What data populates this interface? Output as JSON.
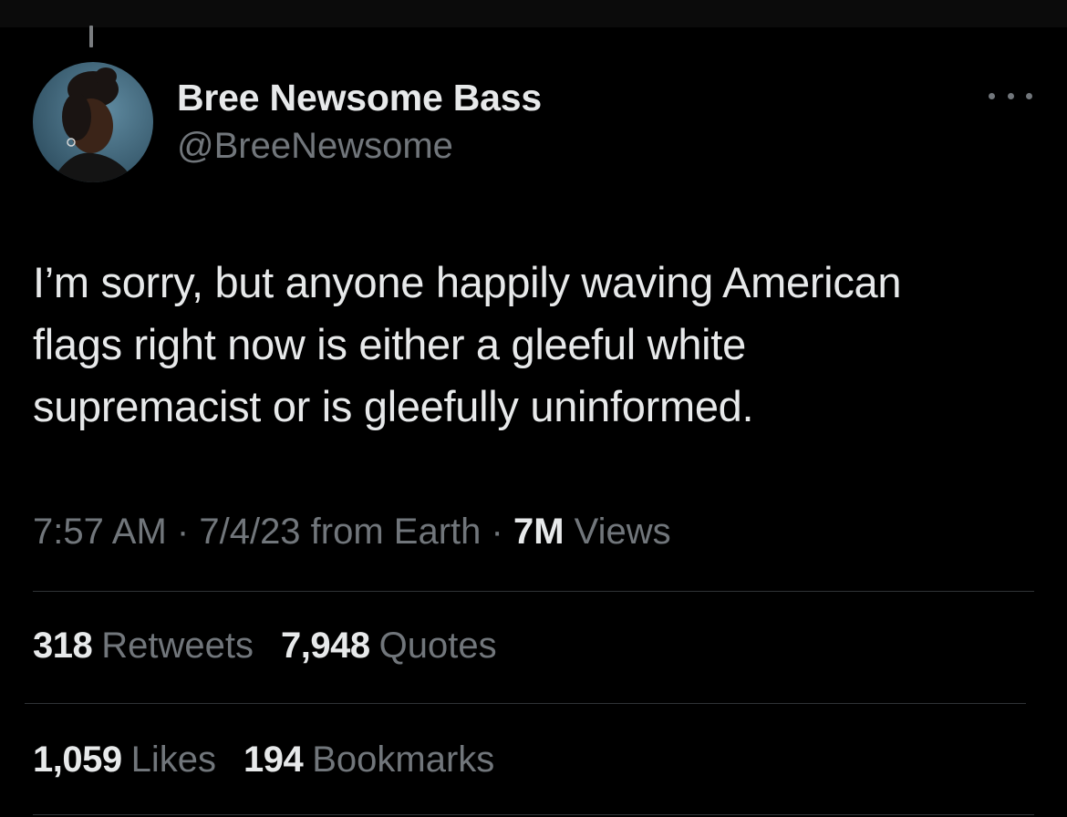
{
  "tweet": {
    "author": {
      "display_name": "Bree Newsome Bass",
      "handle": "@BreeNewsome"
    },
    "text_lines": [
      "I’m sorry, but anyone happily waving American",
      "flags right now is either a gleeful white",
      "supremacist or is gleefully uninformed."
    ],
    "meta": {
      "time": "7:57 AM",
      "separator": "·",
      "date_source": "7/4/23 from Earth",
      "views_count": "7M",
      "views_label": "Views"
    },
    "stats": {
      "retweets": {
        "count": "318",
        "label": "Retweets"
      },
      "quotes": {
        "count": "7,948",
        "label": "Quotes"
      },
      "likes": {
        "count": "1,059",
        "label": "Likes"
      },
      "bookmarks": {
        "count": "194",
        "label": "Bookmarks"
      }
    }
  },
  "icons": {
    "more": "more-options-icon",
    "avatar": "profile-photo"
  },
  "colors": {
    "background": "#000000",
    "primary_text": "#e7e9ea",
    "secondary_text": "#71767b",
    "divider": "#2f3336"
  }
}
